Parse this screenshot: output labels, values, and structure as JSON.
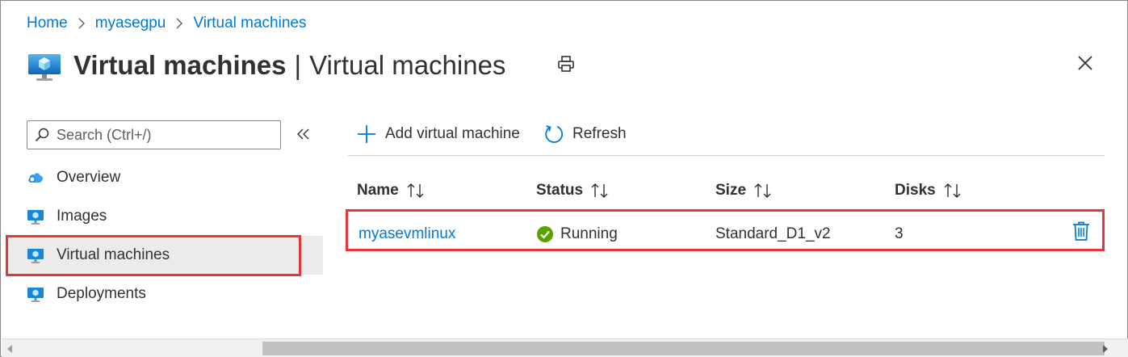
{
  "breadcrumb": {
    "items": [
      "Home",
      "myasegpu",
      "Virtual machines"
    ]
  },
  "header": {
    "title_main": "Virtual machines",
    "title_separator": "|",
    "title_sub": "Virtual machines",
    "icons": [
      "virtual-machine-icon",
      "print-icon",
      "close-icon"
    ]
  },
  "sidebar": {
    "search": {
      "placeholder": "Search (Ctrl+/)",
      "value": ""
    },
    "collapse_icon": "double-chevron-left-icon",
    "items": [
      {
        "label": "Overview",
        "icon": "cloud-icon"
      },
      {
        "label": "Images",
        "icon": "monitor-icon"
      },
      {
        "label": "Virtual machines",
        "icon": "monitor-icon",
        "selected": true
      },
      {
        "label": "Deployments",
        "icon": "monitor-icon"
      }
    ]
  },
  "toolbar": {
    "add_label": "Add virtual machine",
    "refresh_label": "Refresh"
  },
  "table": {
    "columns": [
      "Name",
      "Status",
      "Size",
      "Disks"
    ],
    "rows": [
      {
        "name": "myasevmlinux",
        "status": "Running",
        "size": "Standard_D1_v2",
        "disks": "3"
      }
    ]
  },
  "colors": {
    "link": "#0078d4",
    "highlight": "#e3373c",
    "success": "#57a300",
    "selected_bg": "#edebe9"
  }
}
